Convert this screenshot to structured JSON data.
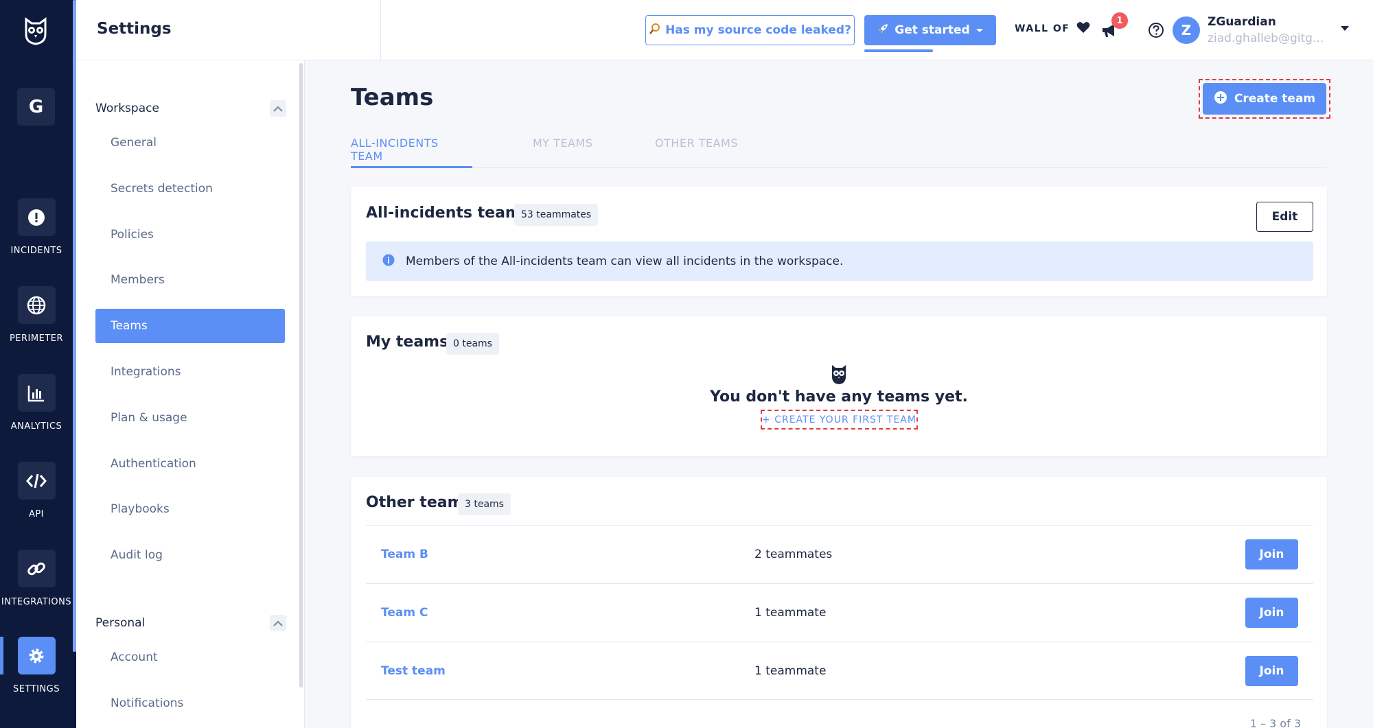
{
  "rail": {
    "workspace_initial": "G",
    "items": [
      {
        "label": "INCIDENTS",
        "icon": "incidents-alert-icon"
      },
      {
        "label": "PERIMETER",
        "icon": "perimeter-globe-icon"
      },
      {
        "label": "ANALYTICS",
        "icon": "analytics-chart-icon"
      },
      {
        "label": "API",
        "icon": "api-code-icon"
      },
      {
        "label": "INTEGRATIONS",
        "icon": "integrations-link-icon"
      },
      {
        "label": "SETTINGS",
        "icon": "settings-gear-icon",
        "active": true
      }
    ]
  },
  "header": {
    "section_title": "Settings",
    "leak_button": "Has my source code leaked?",
    "get_started_button": "Get started",
    "wall_of": "WALL OF",
    "notification_count": "1",
    "user": {
      "initial": "Z",
      "name": "ZGuardian",
      "email": "ziad.ghalleb@gitg..."
    }
  },
  "sidenav": {
    "workspace_group": "Workspace",
    "workspace_items": [
      "General",
      "Secrets detection",
      "Policies",
      "Members",
      "Teams",
      "Integrations",
      "Plan & usage",
      "Authentication",
      "Playbooks",
      "Audit log"
    ],
    "active_item": "Teams",
    "personal_group": "Personal",
    "personal_items": [
      "Account",
      "Notifications"
    ]
  },
  "main": {
    "title": "Teams",
    "create_button": "Create team",
    "tabs": [
      "ALL-INCIDENTS TEAM",
      "MY TEAMS",
      "OTHER TEAMS"
    ],
    "active_tab": "ALL-INCIDENTS TEAM",
    "all_incidents": {
      "title": "All-incidents team",
      "count": "53 teammates",
      "edit_button": "Edit",
      "info": "Members of the All-incidents team can view all incidents in the workspace."
    },
    "my_teams": {
      "title": "My teams",
      "count": "0 teams",
      "empty_message": "You don't have any teams yet.",
      "create_first_link": "+ CREATE YOUR FIRST TEAM"
    },
    "other_teams": {
      "title": "Other teams",
      "count": "3 teams",
      "join_label": "Join",
      "rows": [
        {
          "name": "Team B",
          "members": "2 teammates"
        },
        {
          "name": "Team C",
          "members": "1 teammate"
        },
        {
          "name": "Test team",
          "members": "1 teammate"
        }
      ],
      "pagination": "1 – 3  of  3"
    }
  },
  "colors": {
    "accent": "#5b8ff5",
    "rail_bg": "#0e1a3b",
    "badge": "#f05b5b",
    "highlight_dash": "#e23b3b"
  }
}
